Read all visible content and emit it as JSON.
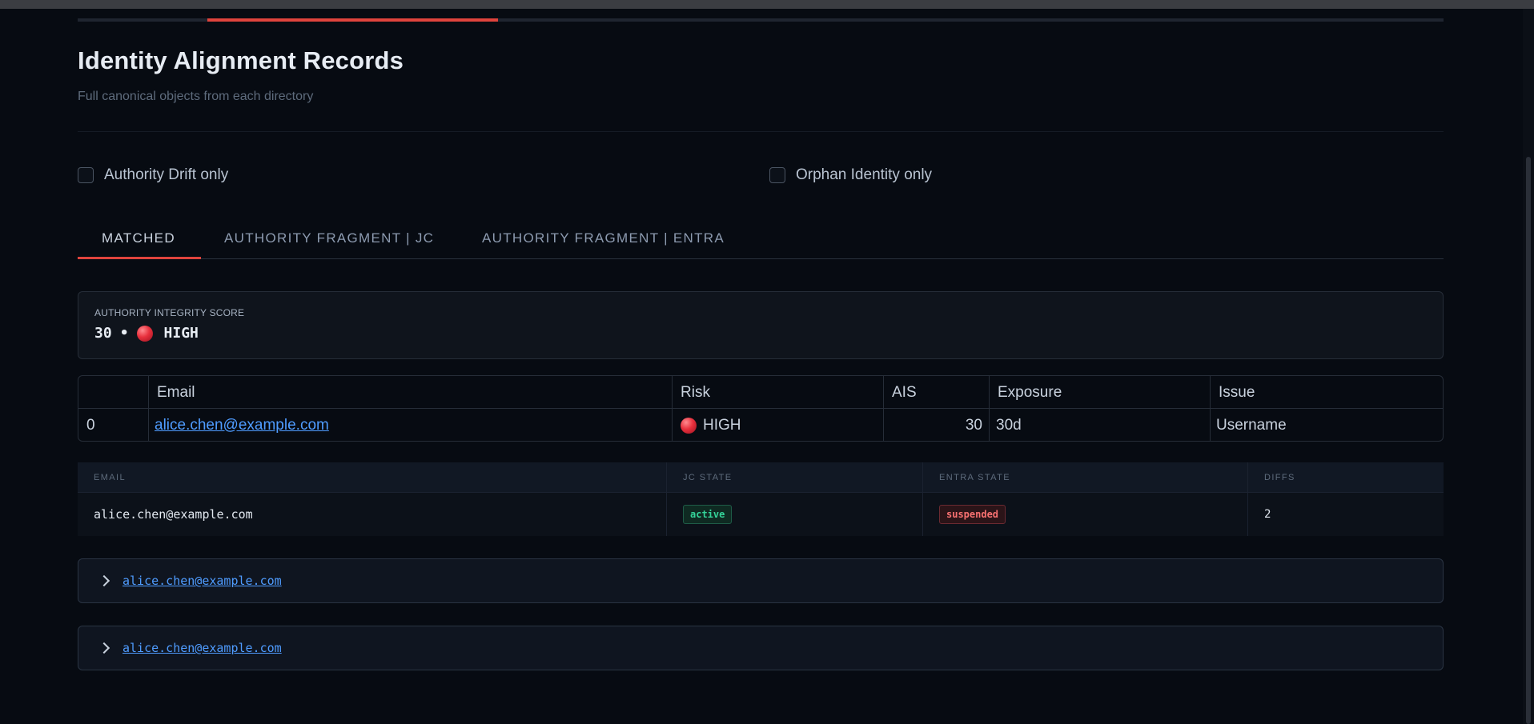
{
  "header": {
    "title": "Identity Alignment Records",
    "subtitle": "Full canonical objects from each directory"
  },
  "filters": {
    "authority_drift_label": "Authority Drift only",
    "orphan_identity_label": "Orphan Identity only"
  },
  "tabs": [
    {
      "label": "MATCHED",
      "active": true
    },
    {
      "label": "AUTHORITY FRAGMENT | JC",
      "active": false
    },
    {
      "label": "AUTHORITY FRAGMENT | ENTRA",
      "active": false
    }
  ],
  "score_card": {
    "label": "AUTHORITY INTEGRITY SCORE",
    "score": "30",
    "separator": "•",
    "level": "HIGH",
    "level_color": "#e8303d"
  },
  "summary_table": {
    "columns": [
      "",
      "Email",
      "Risk",
      "AIS",
      "Exposure",
      "Issue"
    ],
    "rows": [
      {
        "index": "0",
        "email": "alice.chen@example.com",
        "risk": "HIGH",
        "ais": "30",
        "exposure": "30d",
        "issue": "Username"
      }
    ]
  },
  "state_table": {
    "columns": [
      "EMAIL",
      "JC STATE",
      "ENTRA STATE",
      "DIFFS"
    ],
    "rows": [
      {
        "email": "alice.chen@example.com",
        "jc_state": "active",
        "entra_state": "suspended",
        "diffs": "2"
      }
    ]
  },
  "records": [
    {
      "email": "alice.chen@example.com"
    },
    {
      "email": "alice.chen@example.com"
    }
  ],
  "colors": {
    "accent": "#e0443d",
    "link": "#4f9cff",
    "background": "#070b12",
    "active_state": "#34d399",
    "suspended_state": "#f87171"
  }
}
